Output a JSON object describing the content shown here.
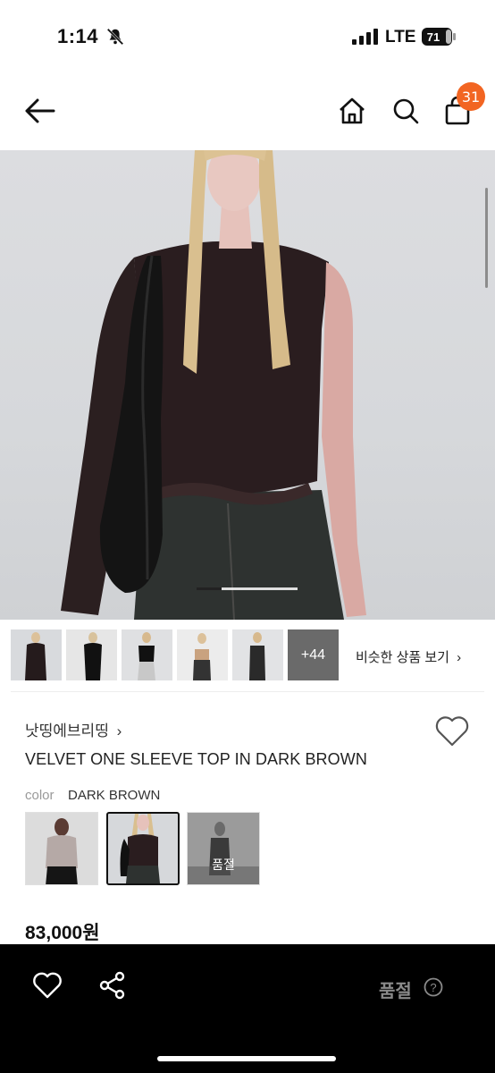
{
  "status_bar": {
    "time": "1:14",
    "network": "LTE",
    "battery": "71"
  },
  "nav": {
    "cart_count": "31",
    "icons": [
      "back-arrow-icon",
      "home-icon",
      "search-icon",
      "shopping-bag-icon"
    ]
  },
  "gallery": {
    "more_count": "+44",
    "similar_label": "비슷한 상품 보기",
    "similar_arrow": "›"
  },
  "product": {
    "brand": "낫띵에브리띵",
    "brand_arrow": "›",
    "name": "VELVET ONE SLEEVE TOP IN DARK BROWN",
    "color_label": "color",
    "color_value": "DARK BROWN",
    "soldout_swatch": "품절",
    "price": "83,000원"
  },
  "bottom_bar": {
    "status": "품절",
    "help": "?",
    "accent": "#f26522"
  }
}
